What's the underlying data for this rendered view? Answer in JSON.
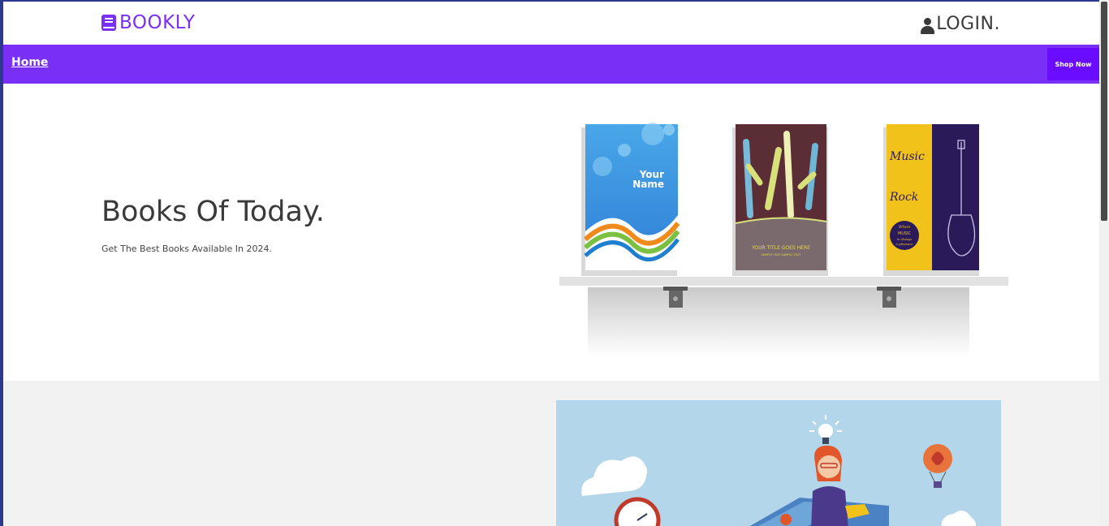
{
  "brand": {
    "name": "BOOKLY",
    "icon": "book-icon",
    "color": "#7a2ff7"
  },
  "header": {
    "login_label": "LOGIN.",
    "login_icon": "user-icon"
  },
  "nav": {
    "home_label": "Home",
    "shop_now_label": "Shop Now",
    "bg_color": "#7a2ff7"
  },
  "hero": {
    "title": "Books Of Today.",
    "subtitle": "Get The Best Books Available In 2024.",
    "books": [
      {
        "line1": "Your",
        "line2": "Name"
      },
      {
        "cover_title": "YOUR TITLE GOES HERE",
        "cover_sub": "SAMPLE TEXT SAMPLE TEXT"
      },
      {
        "word1": "Music",
        "word2": "Rock",
        "badge_line1": "When",
        "badge_line2": "MUSIC",
        "badge_line3": "is always",
        "badge_line4": "a pleasure"
      }
    ]
  },
  "section2": {
    "illustration": "reading-woman-illustration"
  }
}
